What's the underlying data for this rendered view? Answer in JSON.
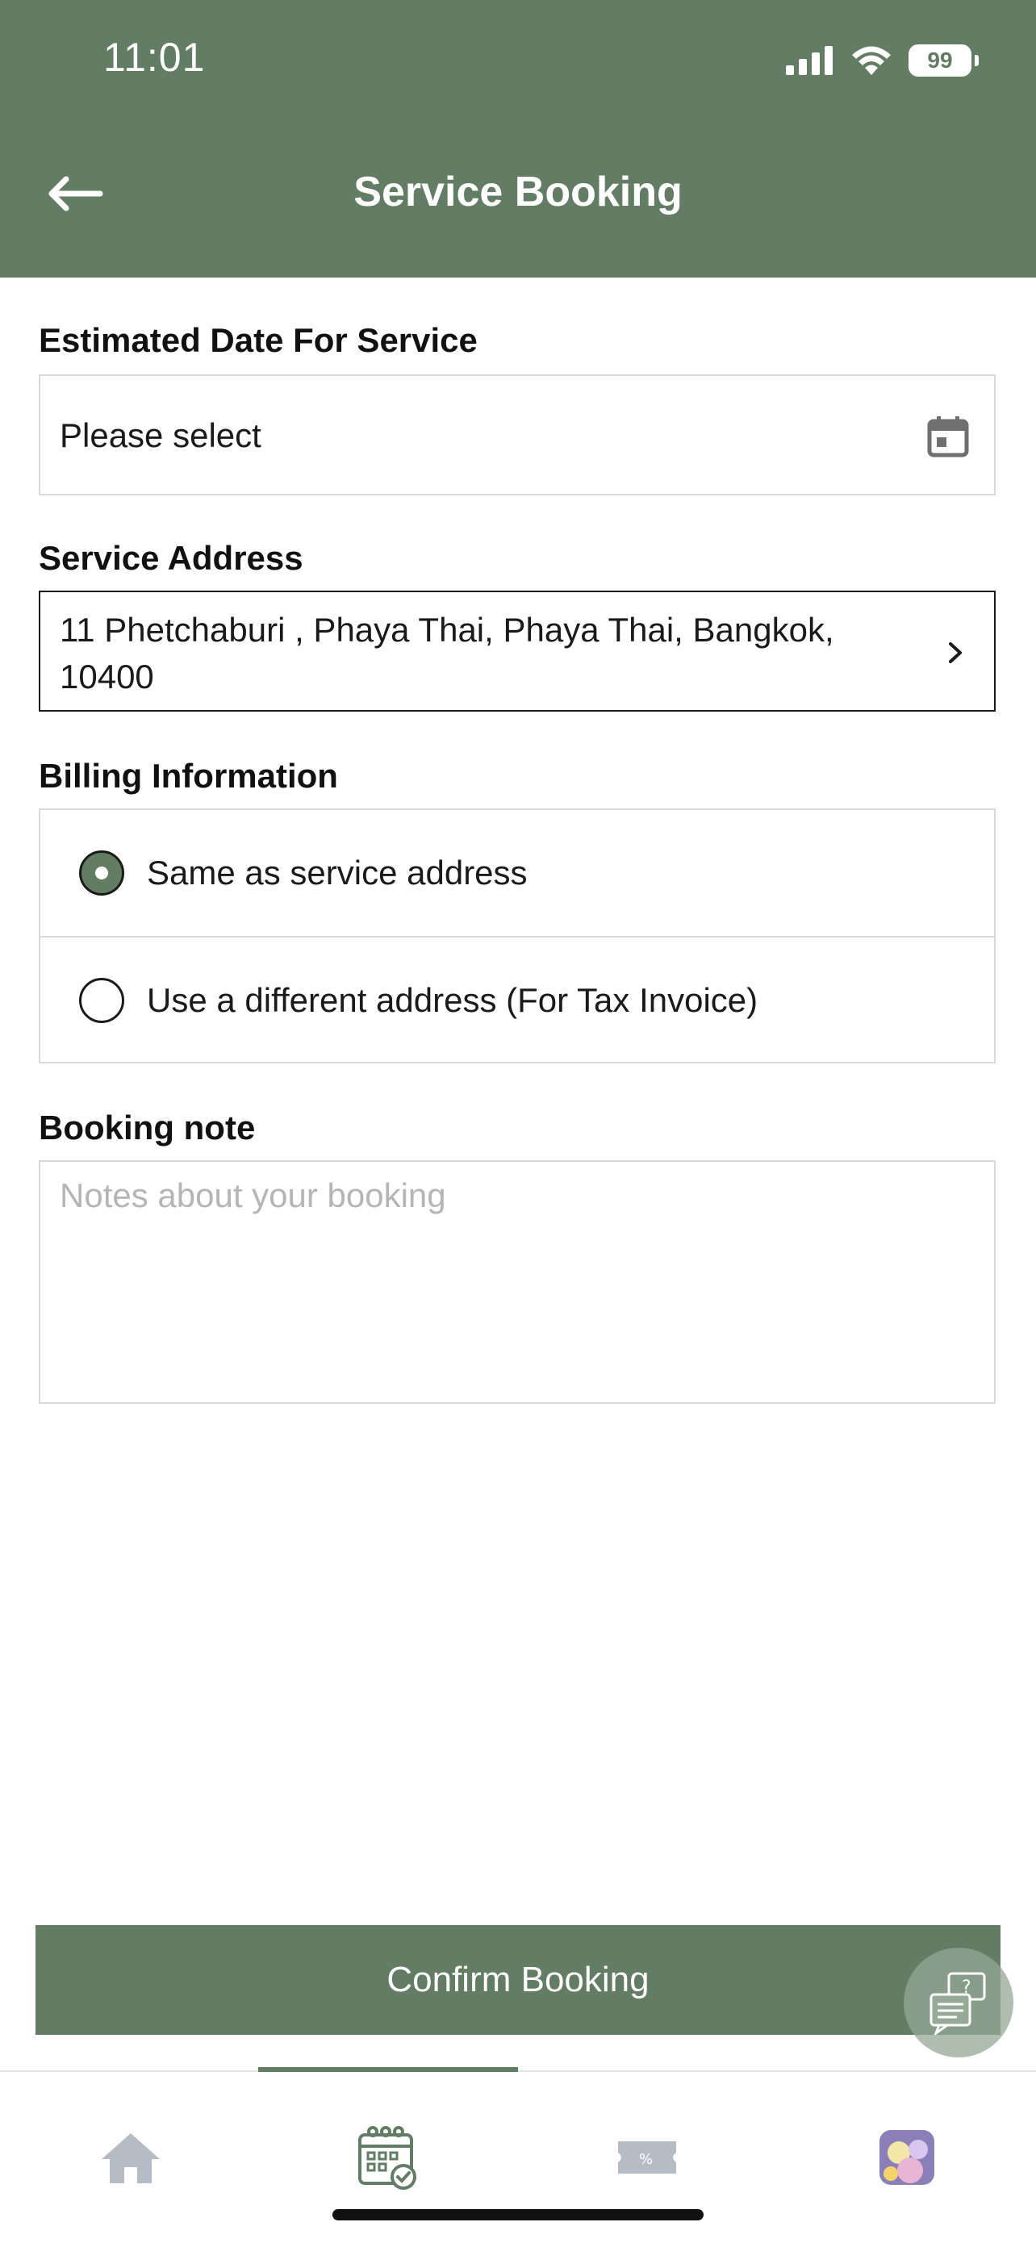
{
  "status_bar": {
    "time": "11:01",
    "battery": "99"
  },
  "header": {
    "title": "Service Booking"
  },
  "date_section": {
    "label": "Estimated Date For Service",
    "value": "Please select"
  },
  "address_section": {
    "label": "Service Address",
    "value": "11 Phetchaburi , Phaya Thai, Phaya Thai, Bangkok, 10400"
  },
  "billing_section": {
    "label": "Billing Information",
    "options": [
      {
        "label": "Same as service address",
        "selected": true
      },
      {
        "label": "Use a different address (For Tax Invoice)",
        "selected": false
      }
    ]
  },
  "note_section": {
    "label": "Booking note",
    "placeholder": "Notes about your booking"
  },
  "confirm_button": {
    "label": "Confirm Booking"
  },
  "tabbar": {
    "items": [
      "home-icon",
      "calendar-check-icon",
      "coupon-icon",
      "profile-avatar-icon"
    ],
    "active_index": 1
  },
  "colors": {
    "brand": "#627d63",
    "border": "#d9d9d9",
    "placeholder": "#b5b5b5"
  }
}
